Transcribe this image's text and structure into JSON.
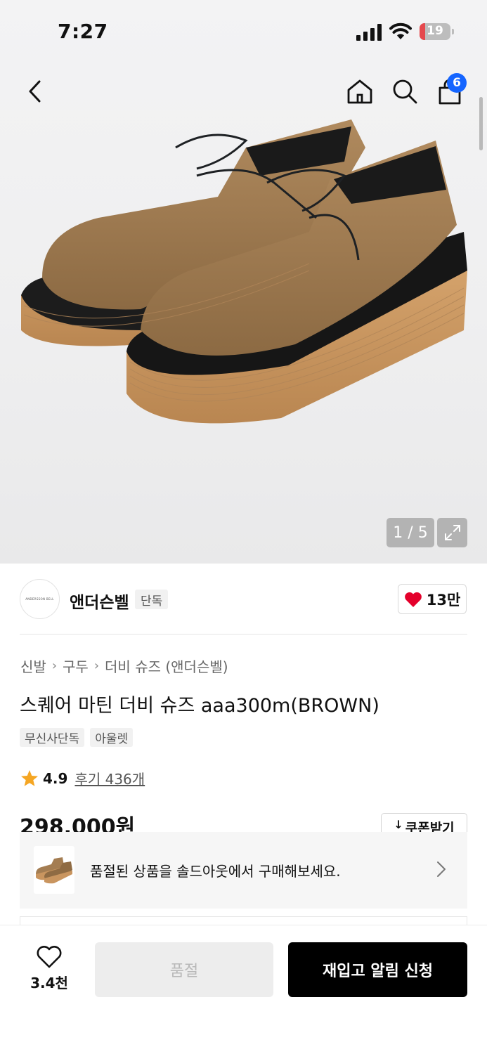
{
  "status_bar": {
    "time": "7:27",
    "battery": "19",
    "battery_level": 0.19,
    "battery_color": "#e5484d"
  },
  "nav": {
    "back_icon": "chevron-left-icon",
    "home_icon": "home-icon",
    "search_icon": "search-icon",
    "cart_icon": "shopping-bag-icon",
    "cart_count": "6",
    "badge_color": "#1565ff"
  },
  "gallery": {
    "counter": "1 / 5",
    "expand_icon": "expand-icon"
  },
  "brand": {
    "name": "앤더슨벨",
    "tag": "단독",
    "logo_text": "ANDERSSON BELL",
    "like_count": "13만",
    "heart_color": "#e4002b"
  },
  "breadcrumb": [
    "신발",
    "구두",
    "더비 슈즈 (앤더슨벨)"
  ],
  "product": {
    "title": "스퀘어 마틴 더비 슈즈 aaa300m(BROWN)",
    "tags": [
      "무신사단독",
      "아울렛"
    ],
    "rating": "4.9",
    "reviews": "후기 436개",
    "price": "298,000원",
    "coupon": "쿠폰받기"
  },
  "soldout_banner": {
    "message": "품절된 상품을 솔드아웃에서 구매해보세요."
  },
  "bottom_bar": {
    "wish_count": "3.4천",
    "soldout_label": "품절",
    "restock_label": "재입고 알림 신청"
  }
}
